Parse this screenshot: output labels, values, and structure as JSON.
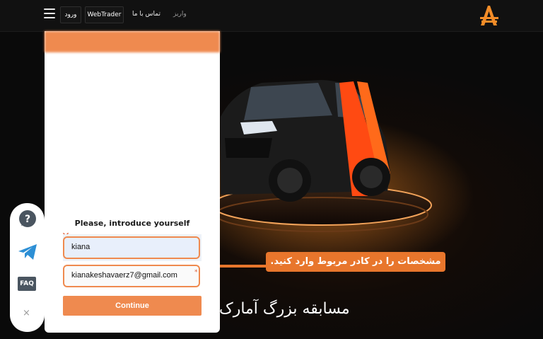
{
  "navbar": {
    "login_label": "ورود",
    "webtrader_label": "WebTrader",
    "contact_label": "تماس با ما",
    "deposit_label": "واریز"
  },
  "hero": {
    "title": "مسابقه بزرگ آمارک"
  },
  "callout": {
    "text": "مشخصات را در کادر مربوط وارد کنید."
  },
  "chat": {
    "intro": "Please, introduce yourself",
    "name_value": "kiana",
    "email_value": "kianakeshavaerz7@gmail.com",
    "required_mark": "*",
    "continue_label": "Continue"
  },
  "sidebar": {
    "faq_label": "FAQ",
    "close_label": "×"
  },
  "colors": {
    "accent": "#ef8a4f",
    "callout": "#e8762c",
    "brand": "#f28c28"
  }
}
